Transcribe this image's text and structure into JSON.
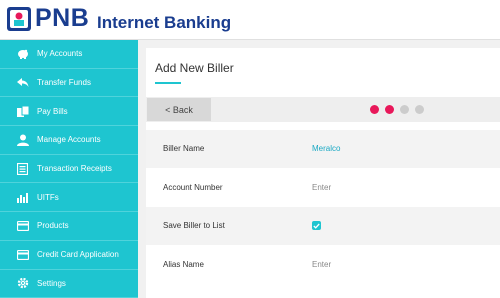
{
  "header": {
    "brand": "PNB",
    "product": "Internet Banking"
  },
  "sidebar": {
    "items": [
      {
        "label": "My Accounts",
        "icon": "piggy-bank-icon"
      },
      {
        "label": "Transfer Funds",
        "icon": "reply-arrow-icon"
      },
      {
        "label": "Pay Bills",
        "icon": "bills-icon"
      },
      {
        "label": "Manage Accounts",
        "icon": "user-icon"
      },
      {
        "label": "Transaction Receipts",
        "icon": "receipt-icon"
      },
      {
        "label": "UITFs",
        "icon": "bar-chart-icon"
      },
      {
        "label": "Products",
        "icon": "card-icon"
      },
      {
        "label": "Credit Card Application",
        "icon": "credit-card-icon"
      },
      {
        "label": "Settings",
        "icon": "gear-icon"
      }
    ]
  },
  "main": {
    "title": "Add New Biller",
    "back_label": "< Back",
    "steps": {
      "total": 4,
      "completed": 2,
      "active_color": "#e8185a",
      "inactive_color": "#cccccc"
    },
    "form": {
      "biller_name_label": "Biller Name",
      "biller_name_value": "Meralco",
      "account_number_label": "Account Number",
      "account_number_placeholder": "Enter",
      "save_biller_label": "Save Biller to List",
      "save_biller_checked": true,
      "alias_name_label": "Alias Name",
      "alias_name_placeholder": "Enter"
    }
  },
  "colors": {
    "brand_blue": "#1a3d8f",
    "sidebar": "#1ec5d0",
    "accent_pink": "#e8185a"
  }
}
